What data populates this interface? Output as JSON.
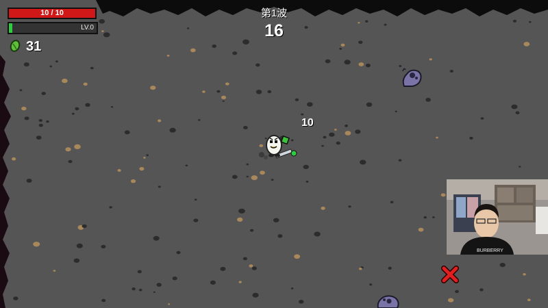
{
  "hud": {
    "hp_text": "10 / 10",
    "hp_fraction": 1.0,
    "xp_level_text": "LV.0",
    "xp_fraction": 0.04,
    "materials_count": "31",
    "wave_label": "第1波",
    "wave_timer": "16"
  },
  "combat": {
    "damage_number": "10"
  },
  "webcam": {
    "shirt_text": "BURBERRY"
  },
  "colors": {
    "ground": "#555555",
    "hp": "#d01818",
    "xp": "#2ecc40",
    "enemy": "#7a73a8",
    "danger_marker": "#e02020"
  },
  "icons": {
    "materials": "green-material-icon",
    "enemy": "purple-slug-alien",
    "player": "white-potato-character",
    "spawn_marker": "red-x-icon"
  }
}
